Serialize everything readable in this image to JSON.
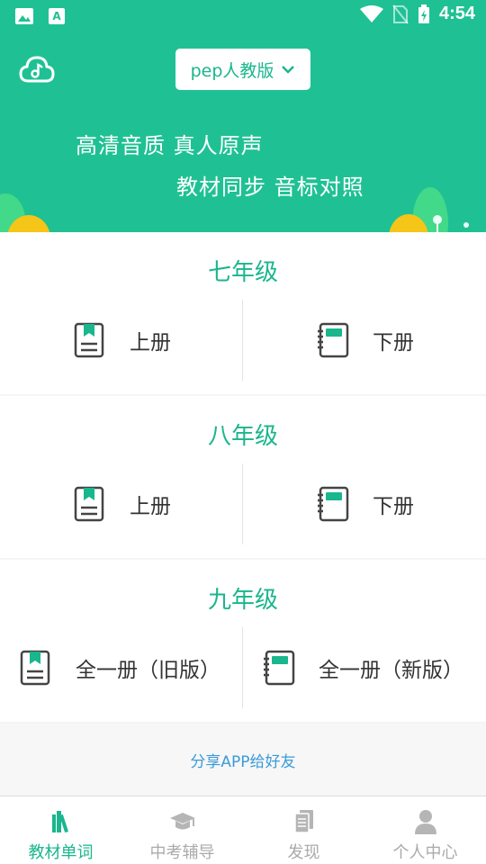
{
  "status_bar": {
    "time": "4:54"
  },
  "header": {
    "version_selected": "pep人教版",
    "slogan_line1": "高清音质 真人原声",
    "slogan_line2": "教材同步 音标对照"
  },
  "grades": [
    {
      "title": "七年级",
      "books": [
        {
          "label": "上册"
        },
        {
          "label": "下册"
        }
      ]
    },
    {
      "title": "八年级",
      "books": [
        {
          "label": "上册"
        },
        {
          "label": "下册"
        }
      ]
    },
    {
      "title": "九年级",
      "books": [
        {
          "label": "全一册（旧版）"
        },
        {
          "label": "全一册（新版）"
        }
      ]
    }
  ],
  "share_text": "分享APP给好友",
  "bottom_nav": [
    {
      "label": "教材单词",
      "icon": "books-icon",
      "active": true
    },
    {
      "label": "中考辅导",
      "icon": "graduation-cap-icon",
      "active": false
    },
    {
      "label": "发现",
      "icon": "document-icon",
      "active": false
    },
    {
      "label": "个人中心",
      "icon": "person-icon",
      "active": false
    }
  ],
  "colors": {
    "accent": "#1ab68d",
    "header_bg": "#1fc194",
    "link": "#3a9bd9"
  }
}
